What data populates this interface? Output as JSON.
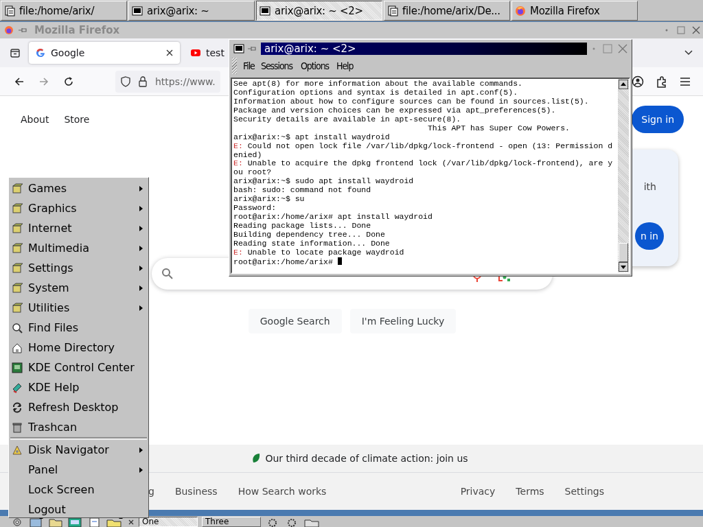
{
  "top_taskbar": {
    "tasks": [
      {
        "label": "file:/home/arix/",
        "kind": "files",
        "selected": false
      },
      {
        "label": "arix@arix: ~",
        "kind": "terminal",
        "selected": false
      },
      {
        "label": "arix@arix: ~ <2>",
        "kind": "terminal",
        "selected": true
      },
      {
        "label": "file:/home/arix/De...",
        "kind": "files",
        "selected": false
      },
      {
        "label": "Mozilla Firefox",
        "kind": "browser",
        "selected": false
      }
    ]
  },
  "firefox": {
    "title": "Mozilla Firefox",
    "tabs": [
      {
        "label": "Google",
        "kind": "google",
        "selected": true
      },
      {
        "label": "test",
        "kind": "video",
        "selected": false
      }
    ],
    "url": "https://www.",
    "page": {
      "header_links": [
        "About",
        "Store"
      ],
      "sign_in": "Sign in",
      "search_buttons": [
        "Google Search",
        "I'm Feeling Lucky"
      ],
      "promo": {
        "text": "ith",
        "button": "n in"
      },
      "climate": "Our third decade of climate action: join us",
      "footer_left": [
        "g",
        "Business",
        "How Search works"
      ],
      "footer_right": [
        "Privacy",
        "Terms",
        "Settings"
      ]
    }
  },
  "terminal": {
    "title": "arix@arix: ~ <2>",
    "menu": [
      "File",
      "Sessions",
      "Options",
      "Help"
    ],
    "lines": [
      {
        "text": "See apt(8) for more information about the available commands."
      },
      {
        "text": "Configuration options and syntax is detailed in apt.conf(5)."
      },
      {
        "text": "Information about how to configure sources can be found in sources.list(5)."
      },
      {
        "text": "Package and version choices can be expressed via apt_preferences(5)."
      },
      {
        "text": "Security details are available in apt-secure(8)."
      },
      {
        "text": "                                         This APT has Super Cow Powers."
      },
      {
        "text": "arix@arix:~$ apt install waydroid"
      },
      {
        "tag": "E:",
        "text": " Could not open lock file /var/lib/dpkg/lock-frontend - open (13: Permission d"
      },
      {
        "text": "enied)"
      },
      {
        "tag": "E:",
        "text": " Unable to acquire the dpkg frontend lock (/var/lib/dpkg/lock-frontend), are y"
      },
      {
        "text": "ou root?"
      },
      {
        "text": "arix@arix:~$ sudo apt install waydroid"
      },
      {
        "text": "bash: sudo: command not found"
      },
      {
        "text": "arix@arix:~$ su"
      },
      {
        "text": "Password:"
      },
      {
        "text": "root@arix:/home/arix# apt install waydroid"
      },
      {
        "text": "Reading package lists... Done"
      },
      {
        "text": "Building dependency tree... Done"
      },
      {
        "text": "Reading state information... Done"
      },
      {
        "tag": "E:",
        "text": " Unable to locate package waydroid"
      },
      {
        "text": "root@arix:/home/arix# ",
        "cursor": true
      }
    ]
  },
  "k_menu": {
    "sections": [
      [
        {
          "label": "Games",
          "has_icon": true,
          "submenu": true
        },
        {
          "label": "Graphics",
          "has_icon": true,
          "submenu": true
        },
        {
          "label": "Internet",
          "has_icon": true,
          "submenu": true
        },
        {
          "label": "Multimedia",
          "has_icon": true,
          "submenu": true
        },
        {
          "label": "Settings",
          "has_icon": true,
          "submenu": true
        },
        {
          "label": "System",
          "has_icon": true,
          "submenu": true
        },
        {
          "label": "Utilities",
          "has_icon": true,
          "submenu": true
        },
        {
          "label": "Find Files",
          "has_icon": true,
          "submenu": false
        },
        {
          "label": "Home Directory",
          "has_icon": true,
          "submenu": false
        },
        {
          "label": "KDE Control Center",
          "has_icon": true,
          "submenu": false
        },
        {
          "label": "KDE Help",
          "has_icon": true,
          "submenu": false
        },
        {
          "label": "Refresh Desktop",
          "has_icon": true,
          "submenu": false
        },
        {
          "label": "Trashcan",
          "has_icon": true,
          "submenu": false
        }
      ],
      [
        {
          "label": "Disk Navigator",
          "has_icon": true,
          "submenu": true
        },
        {
          "label": "Panel",
          "has_icon": false,
          "submenu": true
        },
        {
          "label": "Lock Screen",
          "has_icon": false,
          "submenu": false
        },
        {
          "label": "Logout",
          "has_icon": false,
          "submenu": false
        }
      ]
    ]
  },
  "bottom_panel": {
    "desktops": [
      {
        "label": "One",
        "selected": true
      },
      {
        "label": "Three",
        "selected": false
      }
    ]
  }
}
